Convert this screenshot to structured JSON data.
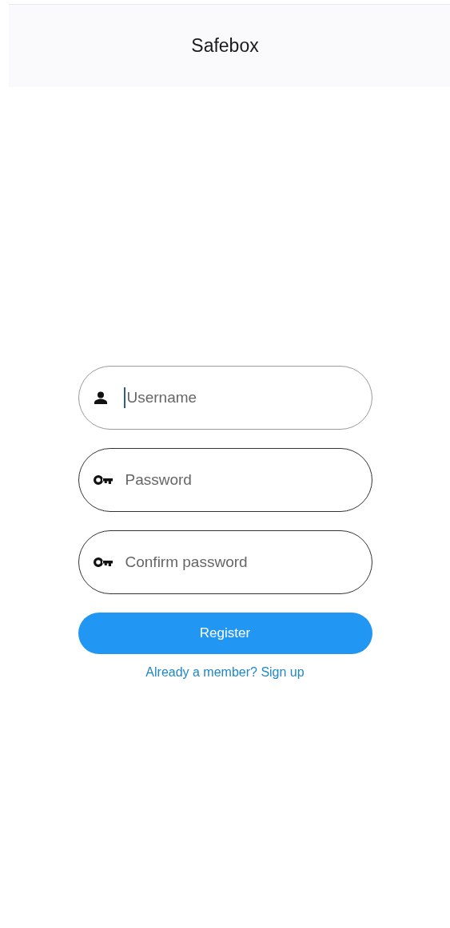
{
  "header": {
    "title": "Safebox"
  },
  "fields": [
    {
      "kind": "person",
      "placeholder": "Username",
      "focused": true
    },
    {
      "kind": "key",
      "placeholder": "Password",
      "focused": false
    },
    {
      "kind": "key",
      "placeholder": "Confirm password",
      "focused": false
    }
  ],
  "register_button": {
    "label": "Register"
  },
  "signin_link": {
    "label": "Already a member? Sign up"
  }
}
